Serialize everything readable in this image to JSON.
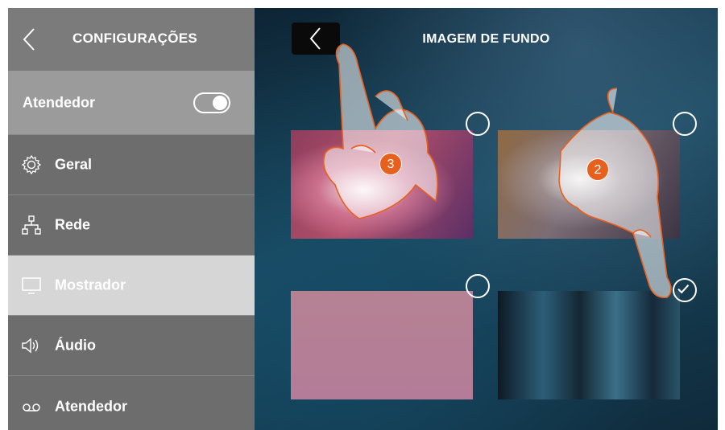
{
  "sidebar": {
    "title": "CONFIGURAÇÕES",
    "rows": [
      {
        "label": "Atendedor",
        "toggle_on": true
      },
      {
        "label": "Geral",
        "icon": "gear-icon"
      },
      {
        "label": "Rede",
        "icon": "network-icon"
      },
      {
        "label": "Mostrador",
        "icon": "monitor-icon",
        "active": true
      },
      {
        "label": "Áudio",
        "icon": "speaker-icon"
      },
      {
        "label": "Atendedor",
        "icon": "voicemail-icon"
      }
    ]
  },
  "main": {
    "title": "IMAGEM DE FUNDO",
    "backgrounds": [
      {
        "selected": false
      },
      {
        "selected": false
      },
      {
        "selected": false
      },
      {
        "selected": true
      }
    ],
    "step_badges": [
      "3",
      "2"
    ]
  },
  "colors": {
    "accent": "#e8601e",
    "sidebar": "#6d6d6d",
    "active_row": "#d6d6d6"
  }
}
